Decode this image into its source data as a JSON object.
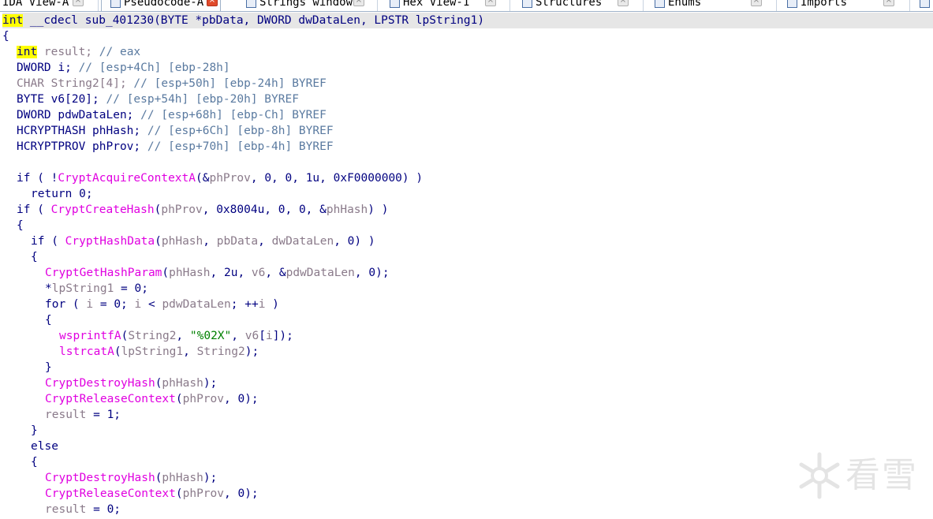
{
  "tabs": [
    {
      "label": "IDA View-A",
      "active": false
    },
    {
      "label": "Pseudocode-A",
      "active": true
    },
    {
      "label": "Strings window",
      "active": false
    },
    {
      "label": "Hex View-1",
      "active": false
    },
    {
      "label": "Structures",
      "active": false
    },
    {
      "label": "Enums",
      "active": false
    },
    {
      "label": "Imports",
      "active": false
    }
  ],
  "code": {
    "signature": {
      "kw": "int",
      "rest": " __cdecl sub_401230(BYTE *pbData, DWORD dwDataLen, LPSTR lpString1)"
    },
    "open_brace": "{",
    "decl_result": {
      "kw": "int",
      "name": " result; ",
      "cmt": "// eax"
    },
    "decl_i": {
      "code": "DWORD i; ",
      "cmt": "// [esp+4Ch] [ebp-28h]"
    },
    "decl_string2": {
      "code": "CHAR String2[4]; ",
      "cmt": "// [esp+50h] [ebp-24h] BYREF"
    },
    "decl_v6": {
      "code": "BYTE v6[20]; ",
      "cmt": "// [esp+54h] [ebp-20h] BYREF"
    },
    "decl_pdw": {
      "code": "DWORD pdwDataLen; ",
      "cmt": "// [esp+68h] [ebp-Ch] BYREF"
    },
    "decl_phhash": {
      "code": "HCRYPTHASH phHash; ",
      "cmt": "// [esp+6Ch] [ebp-8h] BYREF"
    },
    "decl_phprov": {
      "code": "HCRYPTPROV phProv; ",
      "cmt": "// [esp+70h] [ebp-4h] BYREF"
    },
    "if1": {
      "a": "if ( !",
      "fn": "CryptAcquireContextA",
      "b": "(&",
      "v1": "phProv",
      "c": ", 0, 0, 1u, 0xF0000000) )"
    },
    "return0": "return 0;",
    "if2": {
      "a": "if ( ",
      "fn": "CryptCreateHash",
      "b": "(",
      "v1": "phProv",
      "c": ", 0x8004u, 0, 0, &",
      "v2": "phHash",
      "d": ") )"
    },
    "brace_open_1": "{",
    "if3": {
      "a": "if ( ",
      "fn": "CryptHashData",
      "b": "(",
      "v1": "phHash",
      "c": ", ",
      "v2": "pbData",
      "d": ", ",
      "v3": "dwDataLen",
      "e": ", 0) )"
    },
    "brace_open_2": "{",
    "gethash": {
      "fn": "CryptGetHashParam",
      "a": "(",
      "v1": "phHash",
      "b": ", 2u, ",
      "v2": "v6",
      "c": ", &",
      "v3": "pdwDataLen",
      "d": ", 0);"
    },
    "assign": {
      "a": "*",
      "v1": "lpString1",
      "b": " = 0;"
    },
    "for": {
      "a": "for ( ",
      "v1": "i",
      "b": " = 0; ",
      "v2": "i",
      "c": " < ",
      "v3": "pdwDataLen",
      "d": "; ++",
      "v4": "i",
      "e": " )"
    },
    "brace_open_3": "{",
    "wsprintf": {
      "fn": "wsprintfA",
      "a": "(",
      "v1": "String2",
      "b": ", ",
      "str": "\"%02X\"",
      "c": ", ",
      "v2": "v6",
      "d": "[",
      "v3": "i",
      "e": "]);"
    },
    "lstrcat": {
      "fn": "lstrcatA",
      "a": "(",
      "v1": "lpString1",
      "b": ", ",
      "v2": "String2",
      "c": ");"
    },
    "brace_close_3": "}",
    "destroy1": {
      "fn": "CryptDestroyHash",
      "a": "(",
      "v1": "phHash",
      "b": ");"
    },
    "release1": {
      "fn": "CryptReleaseContext",
      "a": "(",
      "v1": "phProv",
      "b": ", 0);"
    },
    "result1": {
      "v1": "result",
      "a": " = 1;"
    },
    "brace_close_2": "}",
    "else": "else",
    "brace_open_4": "{",
    "destroy2": {
      "fn": "CryptDestroyHash",
      "a": "(",
      "v1": "phHash",
      "b": ");"
    },
    "release2": {
      "fn": "CryptReleaseContext",
      "a": "(",
      "v1": "phProv",
      "b": ", 0);"
    },
    "result0": {
      "v1": "result",
      "a": " = 0;"
    }
  },
  "watermark": {
    "text": "看雪"
  },
  "colors": {
    "keyword_highlight": "#ffff00",
    "function": "#e000e0",
    "string": "#008000",
    "comment": "#5a7aa0",
    "text": "#000080",
    "close_active": "#e04a2a"
  }
}
